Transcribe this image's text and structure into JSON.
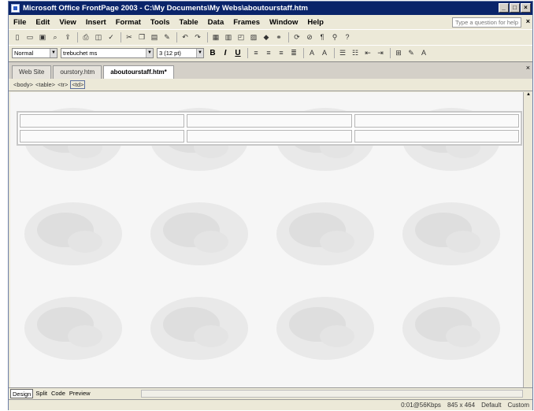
{
  "window": {
    "title": "Microsoft Office FrontPage 2003 - C:\\My Documents\\My Webs\\aboutourstaff.htm"
  },
  "menubar": {
    "items": [
      "File",
      "Edit",
      "View",
      "Insert",
      "Format",
      "Tools",
      "Table",
      "Data",
      "Frames",
      "Window",
      "Help"
    ],
    "ask_placeholder": "Type a question for help"
  },
  "format_toolbar": {
    "style": "Normal",
    "font": "trebuchet ms",
    "size": "3 (12 pt)"
  },
  "tabs": [
    {
      "label": "Web Site",
      "active": false
    },
    {
      "label": "ourstory.htm",
      "active": false
    },
    {
      "label": "aboutourstaff.htm*",
      "active": true
    }
  ],
  "tag_selector": [
    "<body>",
    "<table>",
    "<tr>",
    "<td>"
  ],
  "view_buttons": [
    "Design",
    "Split",
    "Code",
    "Preview"
  ],
  "statusbar": {
    "speed": "0:01@56Kbps",
    "dimensions": "845 x 464",
    "mode": "Default",
    "custom": "Custom"
  },
  "colors": {
    "titlebar": "#0a246a",
    "chrome": "#ece9d8"
  }
}
